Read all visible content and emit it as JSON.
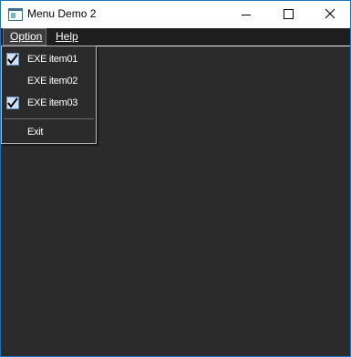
{
  "window": {
    "title": "Menu Demo 2",
    "icon": "app-window-icon"
  },
  "caption_buttons": {
    "minimize_icon": "minimize-icon",
    "maximize_icon": "maximize-icon",
    "close_icon": "close-icon"
  },
  "menubar": {
    "items": [
      {
        "label": "Option",
        "state": "open"
      },
      {
        "label": "Help"
      }
    ]
  },
  "dropdown": {
    "items": [
      {
        "label": "EXE item01",
        "checked": true
      },
      {
        "label": "EXE item02",
        "checked": false
      },
      {
        "label": "EXE item03",
        "checked": true
      },
      {
        "label": "Exit",
        "checked": false
      }
    ]
  },
  "colors": {
    "client_background": "#2b2b2b",
    "menubar_background": "#1e1e1e",
    "check_background": "#cfe0f5",
    "window_border": "#1c75bc"
  }
}
